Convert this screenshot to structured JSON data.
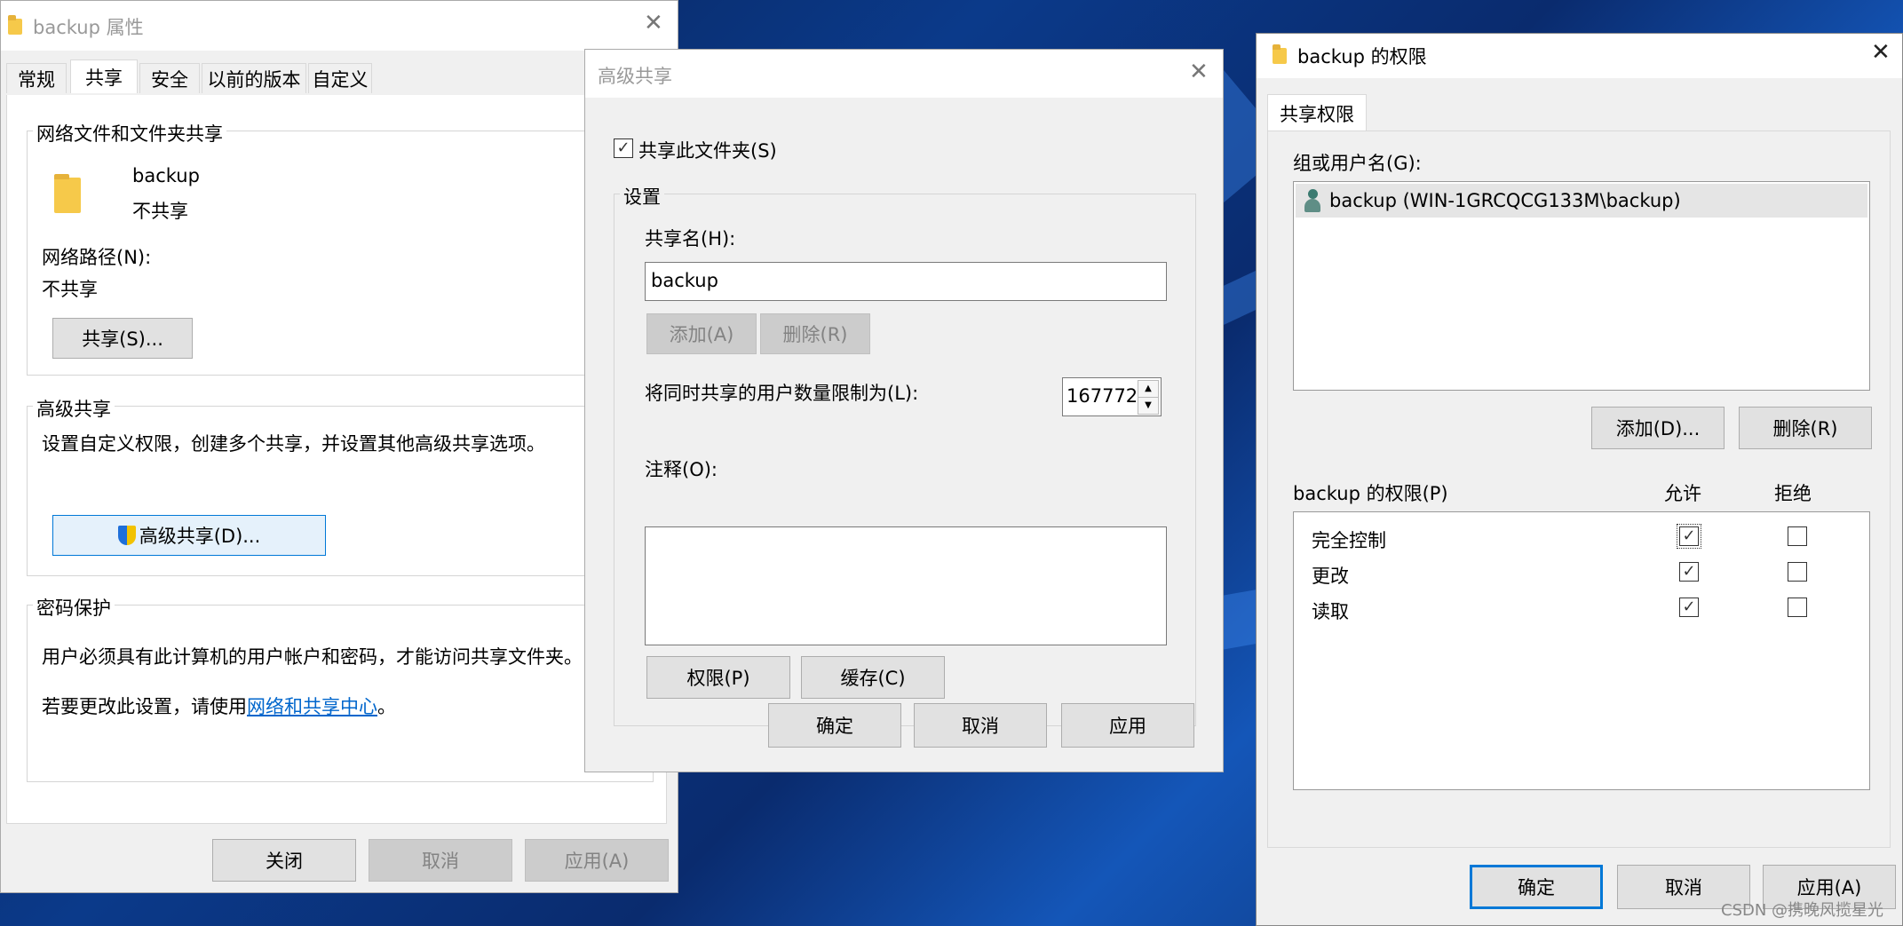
{
  "props": {
    "title": "backup 属性",
    "tabs": [
      "常规",
      "共享",
      "安全",
      "以前的版本",
      "自定义"
    ],
    "share_group": "网络文件和文件夹共享",
    "folder_name": "backup",
    "share_status": "不共享",
    "net_path_label": "网络路径(N):",
    "net_path_value": "不共享",
    "share_btn": "共享(S)...",
    "adv_group": "高级共享",
    "adv_desc": "设置自定义权限，创建多个共享，并设置其他高级共享选项。",
    "adv_btn": "高级共享(D)...",
    "pwd_group": "密码保护",
    "pwd_desc": "用户必须具有此计算机的用户帐户和密码，才能访问共享文件夹。",
    "pwd_change_prefix": "若要更改此设置，请使用",
    "pwd_link": "网络和共享中心",
    "pwd_suffix": "。",
    "btn_close": "关闭",
    "btn_cancel": "取消",
    "btn_apply": "应用(A)"
  },
  "adv": {
    "title": "高级共享",
    "share_checkbox": "共享此文件夹(S)",
    "settings_group": "设置",
    "share_name_label": "共享名(H):",
    "share_name_value": "backup",
    "add_btn": "添加(A)",
    "remove_btn": "删除(R)",
    "limit_label": "将同时共享的用户数量限制为(L):",
    "limit_value": "167772",
    "comment_label": "注释(O):",
    "perm_btn": "权限(P)",
    "cache_btn": "缓存(C)",
    "ok": "确定",
    "cancel": "取消",
    "apply": "应用"
  },
  "perm": {
    "title": "backup 的权限",
    "tab": "共享权限",
    "users_label": "组或用户名(G):",
    "user": "backup (WIN-1GRCQCG133M\\backup)",
    "add_btn": "添加(D)...",
    "remove_btn": "删除(R)",
    "perm_label": "backup 的权限(P)",
    "col_allow": "允许",
    "col_deny": "拒绝",
    "rows": [
      {
        "name": "完全控制",
        "allow": true,
        "deny": false
      },
      {
        "name": "更改",
        "allow": true,
        "deny": false
      },
      {
        "name": "读取",
        "allow": true,
        "deny": false
      }
    ],
    "ok": "确定",
    "cancel": "取消",
    "apply": "应用(A)"
  },
  "watermark": "CSDN @携晚风揽星光"
}
